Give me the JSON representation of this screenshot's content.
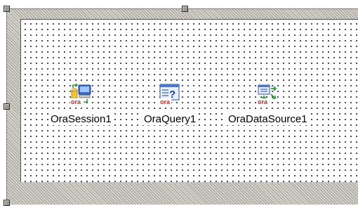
{
  "form": {
    "components": [
      {
        "label": "OraSession1",
        "icon": "ora-session-icon",
        "badge": "ora"
      },
      {
        "label": "OraQuery1",
        "icon": "ora-query-icon",
        "badge": "ora"
      },
      {
        "label": "OraDataSource1",
        "icon": "ora-datasource-icon",
        "badge": "ora"
      }
    ]
  },
  "colors": {
    "ora_badge": "#e02020",
    "surface": "#ffffff",
    "frame": "#d4d0c8"
  }
}
